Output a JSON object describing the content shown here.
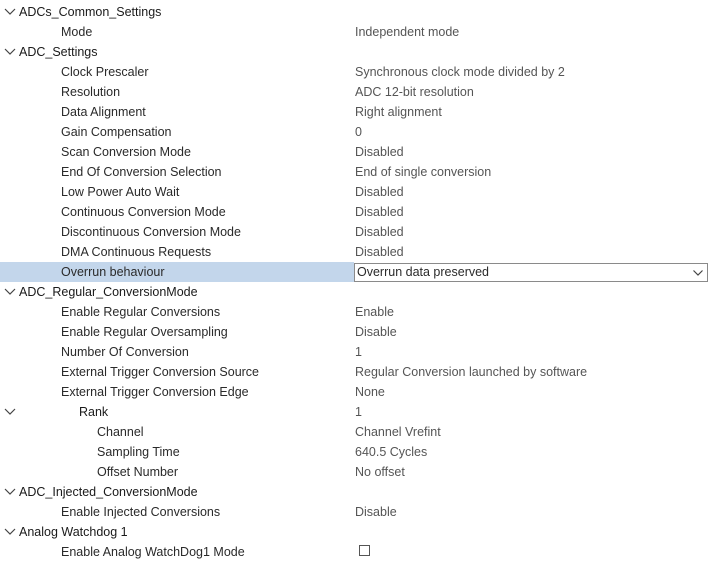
{
  "groups": {
    "adcs_common": "ADCs_Common_Settings",
    "adc_settings": "ADC_Settings",
    "regular": "ADC_Regular_ConversionMode",
    "rank": "Rank",
    "injected": "ADC_Injected_ConversionMode",
    "watchdog": "Analog Watchdog 1"
  },
  "rows": {
    "mode": {
      "label": "Mode",
      "value": "Independent mode"
    },
    "clock_prescaler": {
      "label": "Clock Prescaler",
      "value": "Synchronous clock mode divided by 2"
    },
    "resolution": {
      "label": "Resolution",
      "value": "ADC 12-bit resolution"
    },
    "data_alignment": {
      "label": "Data Alignment",
      "value": "Right alignment"
    },
    "gain_compensation": {
      "label": "Gain Compensation",
      "value": "0"
    },
    "scan_conversion": {
      "label": "Scan Conversion Mode",
      "value": "Disabled"
    },
    "eoc_selection": {
      "label": "End Of Conversion Selection",
      "value": "End of single conversion"
    },
    "low_power_wait": {
      "label": "Low Power Auto Wait",
      "value": "Disabled"
    },
    "continuous": {
      "label": "Continuous Conversion Mode",
      "value": "Disabled"
    },
    "discontinuous": {
      "label": "Discontinuous Conversion Mode",
      "value": "Disabled"
    },
    "dma_continuous": {
      "label": "DMA Continuous Requests",
      "value": "Disabled"
    },
    "overrun": {
      "label": "Overrun behaviour",
      "value": "Overrun data preserved"
    },
    "enable_regular": {
      "label": "Enable Regular Conversions",
      "value": "Enable"
    },
    "regular_oversampling": {
      "label": "Enable Regular Oversampling",
      "value": "Disable"
    },
    "num_conversion": {
      "label": "Number Of Conversion",
      "value": "1"
    },
    "ext_trigger_source": {
      "label": "External Trigger Conversion Source",
      "value": "Regular Conversion launched by software"
    },
    "ext_trigger_edge": {
      "label": "External Trigger Conversion Edge",
      "value": "None"
    },
    "rank_value": "1",
    "channel": {
      "label": "Channel",
      "value": "Channel Vrefint"
    },
    "sampling_time": {
      "label": "Sampling Time",
      "value": "640.5 Cycles"
    },
    "offset_number": {
      "label": "Offset Number",
      "value": "No offset"
    },
    "enable_injected": {
      "label": "Enable Injected Conversions",
      "value": "Disable"
    },
    "watchdog_mode": {
      "label": "Enable Analog WatchDog1 Mode",
      "checked": false
    }
  },
  "icons": {
    "expand": "chevron-down-icon",
    "dropdown": "chevron-down-icon",
    "checkbox": "checkbox-unchecked"
  },
  "colors": {
    "selected_row": "#c3d6eb",
    "value_text": "#555555",
    "combo_border": "#8a8a8a"
  }
}
